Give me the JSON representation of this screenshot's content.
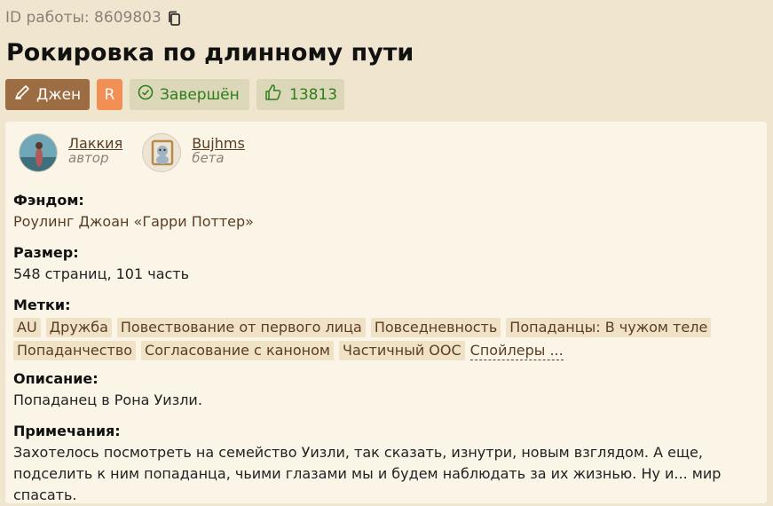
{
  "work_id_label": "ID работы: 8609803",
  "title": "Рокировка по длинному пути",
  "badges": {
    "direction": "Джен",
    "rating": "R",
    "status": "Завершён",
    "likes": "13813"
  },
  "people": [
    {
      "name": "Лаккия",
      "role": "автор"
    },
    {
      "name": "Bujhms",
      "role": "бета"
    }
  ],
  "fandom": {
    "label": "Фэндом:",
    "value": "Роулинг Джоан «Гарри Поттер»"
  },
  "size": {
    "label": "Размер:",
    "value": "548 страниц, 101 часть"
  },
  "tags": {
    "label": "Метки:",
    "items": [
      "AU",
      "Дружба",
      "Повествование от первого лица",
      "Повседневность",
      "Попаданцы: В чужом теле",
      "Попаданчество",
      "Согласование с каноном",
      "Частичный ООС"
    ],
    "more": "Спойлеры ..."
  },
  "description": {
    "label": "Описание:",
    "value": "Попаданец в Рона Уизли."
  },
  "notes": {
    "label": "Примечания:",
    "value": "Захотелось посмотреть на семейство Уизли, так сказать, изнутри, новым взглядом. А еще, подселить к ним попаданца, чьими глазами мы и будем наблюдать за их жизнью. Ну и... мир спасать."
  },
  "colors": {
    "background": "#f0e6d0",
    "panel": "#fbf5e8",
    "direction_badge": "#9c6d42",
    "rating_badge": "#f28f55",
    "status_text": "#2e7d1a",
    "tag_bg": "#efe2c7",
    "link": "#5b3d22"
  },
  "icons": {
    "copy": "copy-icon",
    "direction": "pen-icon",
    "status": "check-circle-icon",
    "likes": "thumbs-up-icon"
  }
}
